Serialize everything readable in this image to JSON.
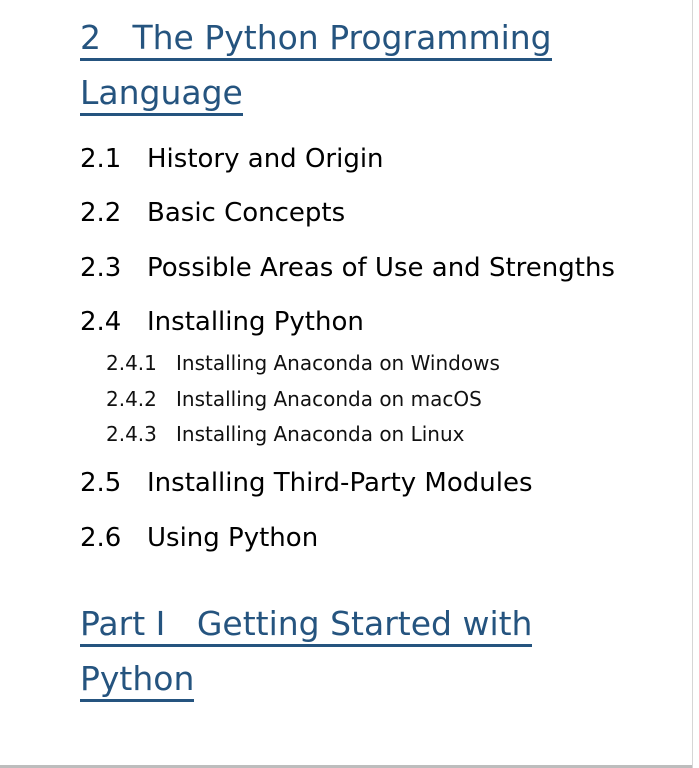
{
  "chapter": {
    "title_line1": "2   The Python Programming",
    "title_line2": "Language"
  },
  "sections": [
    {
      "num": "2.1",
      "title": "History and Origin"
    },
    {
      "num": "2.2",
      "title": "Basic Concepts"
    },
    {
      "num": "2.3",
      "title": "Possible Areas of Use and Strengths"
    },
    {
      "num": "2.4",
      "title": "Installing Python"
    },
    {
      "num": "2.5",
      "title": "Installing Third-Party Modules"
    },
    {
      "num": "2.6",
      "title": "Using Python"
    }
  ],
  "subsections": [
    {
      "num": "2.4.1",
      "title": "Installing Anaconda on Windows"
    },
    {
      "num": "2.4.2",
      "title": "Installing Anaconda on macOS"
    },
    {
      "num": "2.4.3",
      "title": "Installing Anaconda on Linux"
    }
  ],
  "part": {
    "title_line1": "Part I   Getting Started with",
    "title_line2": "Python"
  },
  "colors": {
    "link": "#25547f",
    "text": "#000000"
  }
}
